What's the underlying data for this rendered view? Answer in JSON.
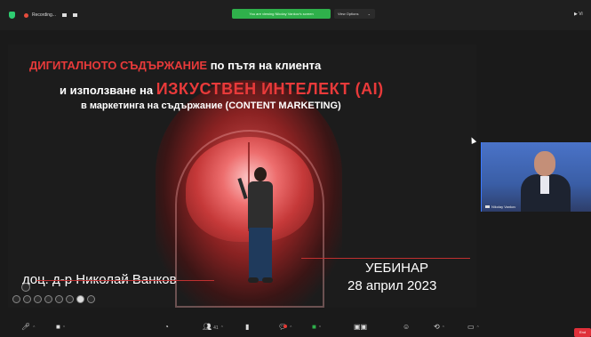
{
  "topbar": {
    "recording_label": "Recording...",
    "share_banner": "You are viewing Nikolay Vankov's screen",
    "view_options": "View Options",
    "view_options_chevron": "⌄",
    "top_right": "▶ Vi"
  },
  "slide": {
    "line1_red": "ДИГИТАЛНОТО СЪДЪРЖАНИЕ",
    "line1_white": " по пътя на клиента",
    "line2_white": "и използване на ",
    "line2_red": "ИЗКУСТВЕН ИНТЕЛЕКТ (AI)",
    "line3": "в маркетинга на съдържание (CONTENT MARKETING)",
    "author": "доц. д-р Николай Ванков",
    "event": "УЕБИНАР",
    "date": "28 април 2023"
  },
  "participant": {
    "name": "Nikolay Vankov"
  },
  "toolbar": {
    "items": [
      {
        "icon": "microphone-icon",
        "glyph": "🎤︎",
        "caret": "⌃"
      },
      {
        "icon": "video-icon",
        "glyph": "■",
        "caret": "⌃"
      },
      {
        "icon": "security-icon",
        "glyph": "◔",
        "caret": ""
      },
      {
        "icon": "participants-icon",
        "glyph": "👥︎",
        "count": "41",
        "caret": "⌃"
      },
      {
        "icon": "polls-icon",
        "glyph": "▮",
        "caret": ""
      },
      {
        "icon": "chat-icon",
        "glyph": "💬︎",
        "caret": "⌃"
      },
      {
        "icon": "share-screen-icon",
        "glyph": "■",
        "caret": "⌃"
      },
      {
        "icon": "view-icon",
        "glyph": "▣▣",
        "caret": ""
      },
      {
        "icon": "reactions-icon",
        "glyph": "☺",
        "caret": ""
      },
      {
        "icon": "apps-icon",
        "glyph": "⟲",
        "caret": "⌃"
      },
      {
        "icon": "more-icon",
        "glyph": "▭",
        "caret": "⌃"
      }
    ],
    "end_label": "End"
  },
  "colors": {
    "accent_red": "#e83a3a",
    "share_green": "#2fb04b",
    "end_red": "#e0303a"
  }
}
